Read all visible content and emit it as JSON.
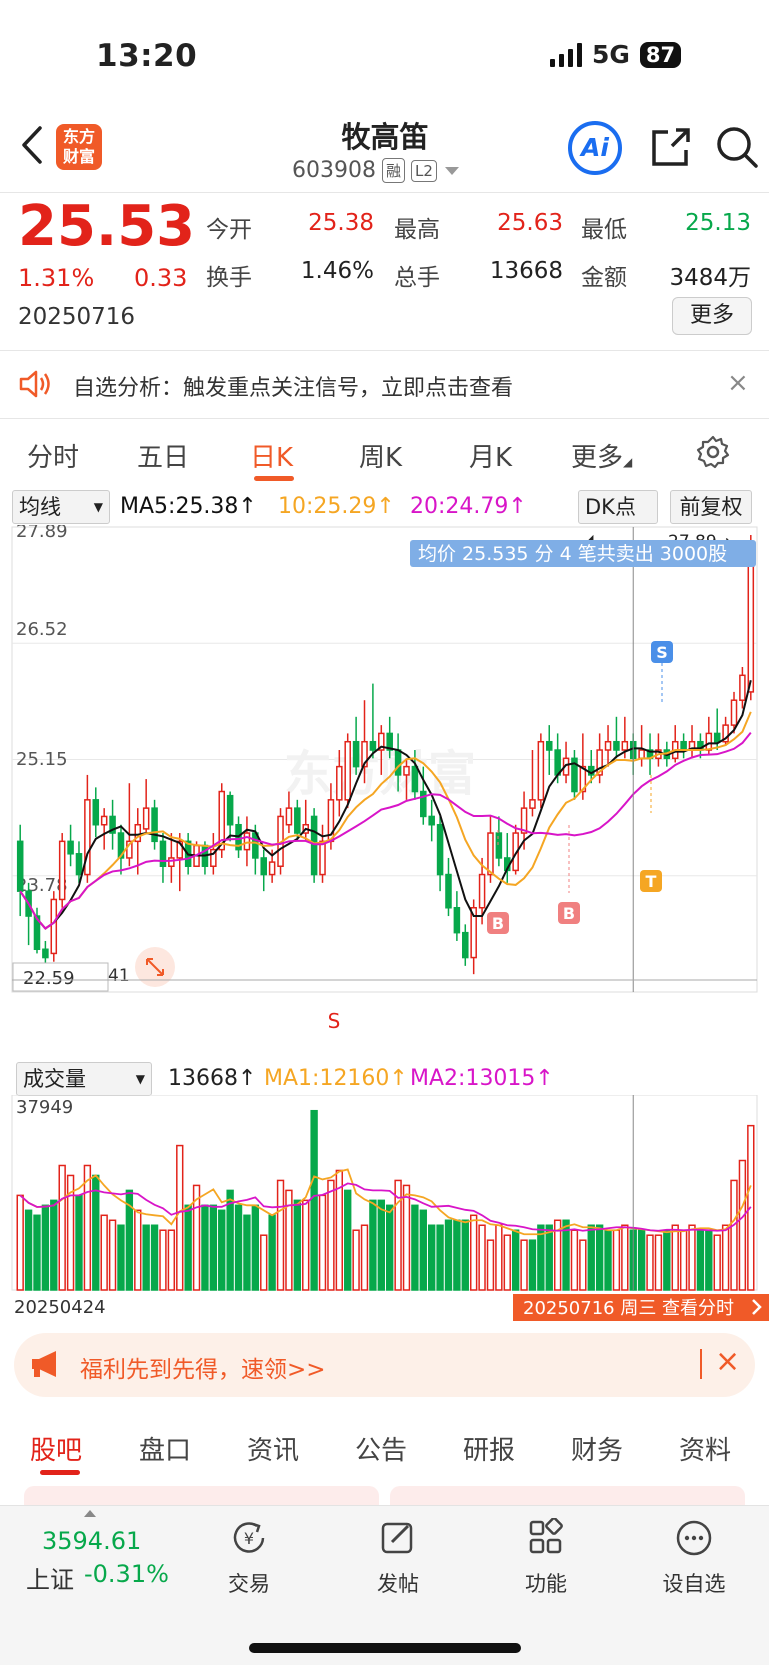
{
  "status": {
    "time": "13:20",
    "network": "5G",
    "battery": "87"
  },
  "header": {
    "logo_line1": "东方",
    "logo_line2": "财富",
    "stock_name": "牧高笛",
    "stock_code": "603908",
    "tag_margin": "融",
    "tag_level": "L2",
    "ai_label": "Ai"
  },
  "quote": {
    "price": "25.53",
    "change_pct": "1.31%",
    "change_amt": "0.33",
    "date": "20250716",
    "open_label": "今开",
    "open": "25.38",
    "high_label": "最高",
    "high": "25.63",
    "low_label": "最低",
    "low": "25.13",
    "turnover_label": "换手",
    "turnover": "1.46%",
    "volume_label": "总手",
    "volume": "13668",
    "amount_label": "金额",
    "amount": "3484万",
    "more_label": "更多"
  },
  "notice": {
    "text": "自选分析：触发重点关注信号，立即点击查看",
    "close": "×"
  },
  "chart_tabs": [
    "分时",
    "五日",
    "日K",
    "周K",
    "月K",
    "更多"
  ],
  "active_chart_tab": "日K",
  "ma_row": {
    "indicator_select": "均线",
    "ma5": "MA5:25.38↑",
    "ma10": "10:25.29↑",
    "ma20": "20:24.79↑",
    "dk_select": "DK点",
    "adjust_button": "前复权"
  },
  "price_axis": [
    "27.89",
    "26.52",
    "25.15",
    "23.78",
    "22.59"
  ],
  "cursor_price_label": "27.89→",
  "trade_tooltip": "均价 25.535 分 4 笔共卖出 3000股",
  "watermark": "东方财富",
  "low_price_marker": "41",
  "markers": {
    "s_top": "S",
    "s_bottom": "S",
    "b1": "B",
    "b2": "B",
    "t": "T"
  },
  "volume_row": {
    "indicator_select": "成交量",
    "value": "13668↑",
    "ma1": "MA1:12160↑",
    "ma2": "MA2:13015↑",
    "max_label": "37949",
    "start_date": "20250424",
    "cursor_info": "20250716 周三 查看分时"
  },
  "colors": {
    "up": "#e2231a",
    "down": "#07a84b",
    "ma5": "#111111",
    "ma10": "#f5a623",
    "ma20": "#d815c8",
    "accent": "#f05a28"
  },
  "chart_data": {
    "type": "candlestick",
    "ylim": [
      22.59,
      27.89
    ],
    "candles": [
      [
        24.2,
        23.6,
        24.4,
        23.3
      ],
      [
        23.6,
        23.3,
        23.7,
        22.95
      ],
      [
        23.3,
        22.9,
        23.4,
        22.85
      ],
      [
        22.9,
        22.8,
        23.0,
        22.7
      ],
      [
        22.85,
        23.5,
        23.6,
        22.75
      ],
      [
        23.5,
        24.2,
        24.3,
        23.4
      ],
      [
        24.2,
        24.05,
        24.4,
        23.9
      ],
      [
        24.05,
        23.8,
        24.2,
        23.7
      ],
      [
        23.8,
        24.7,
        25.0,
        23.7
      ],
      [
        24.7,
        24.4,
        24.85,
        24.25
      ],
      [
        24.4,
        24.5,
        24.6,
        24.1
      ],
      [
        24.5,
        24.3,
        24.7,
        24.1
      ],
      [
        24.3,
        24.0,
        24.4,
        23.8
      ],
      [
        24.0,
        24.2,
        24.9,
        23.9
      ],
      [
        24.2,
        24.4,
        24.6,
        23.8
      ],
      [
        24.35,
        24.6,
        24.95,
        24.3
      ],
      [
        24.6,
        24.2,
        24.7,
        24.1
      ],
      [
        24.2,
        23.9,
        24.3,
        23.7
      ],
      [
        23.9,
        24.0,
        24.3,
        23.7
      ],
      [
        24.0,
        24.2,
        24.3,
        23.6
      ],
      [
        24.2,
        23.9,
        24.3,
        23.8
      ],
      [
        23.9,
        24.15,
        24.2,
        23.9
      ],
      [
        24.15,
        23.9,
        24.2,
        23.8
      ],
      [
        23.9,
        24.1,
        24.3,
        23.8
      ],
      [
        24.1,
        24.8,
        24.9,
        24.0
      ],
      [
        24.75,
        24.4,
        24.8,
        24.2
      ],
      [
        24.4,
        24.1,
        24.5,
        24.0
      ],
      [
        24.1,
        24.3,
        24.5,
        23.9
      ],
      [
        24.3,
        24.0,
        24.4,
        23.8
      ],
      [
        24.0,
        23.8,
        24.1,
        23.6
      ],
      [
        23.8,
        23.95,
        24.1,
        23.7
      ],
      [
        23.9,
        24.5,
        24.6,
        23.8
      ],
      [
        24.4,
        24.6,
        24.8,
        24.3
      ],
      [
        24.6,
        24.3,
        24.7,
        24.2
      ],
      [
        24.3,
        24.4,
        24.7,
        24.2
      ],
      [
        24.5,
        23.8,
        24.6,
        23.7
      ],
      [
        23.8,
        24.2,
        24.4,
        23.7
      ],
      [
        24.2,
        24.7,
        24.9,
        24.1
      ],
      [
        24.7,
        25.1,
        25.3,
        24.5
      ],
      [
        24.7,
        25.4,
        25.5,
        24.6
      ],
      [
        25.4,
        25.1,
        25.7,
        25.0
      ],
      [
        25.1,
        25.4,
        25.9,
        24.9
      ],
      [
        25.4,
        25.3,
        26.1,
        25.2
      ],
      [
        25.3,
        25.5,
        25.6,
        25.0
      ],
      [
        25.5,
        25.3,
        25.7,
        25.2
      ],
      [
        25.3,
        25.0,
        25.5,
        24.8
      ],
      [
        25.0,
        25.1,
        25.2,
        24.7
      ],
      [
        25.1,
        24.8,
        25.3,
        24.7
      ],
      [
        24.8,
        24.5,
        25.1,
        24.4
      ],
      [
        24.5,
        24.4,
        24.7,
        24.2
      ],
      [
        24.4,
        23.8,
        24.5,
        23.6
      ],
      [
        23.8,
        23.4,
        24.0,
        23.3
      ],
      [
        23.4,
        23.1,
        23.6,
        23.0
      ],
      [
        23.1,
        22.8,
        23.2,
        22.7
      ],
      [
        22.8,
        23.4,
        23.5,
        22.6
      ],
      [
        23.4,
        23.8,
        24.0,
        23.2
      ],
      [
        23.8,
        24.3,
        24.5,
        23.7
      ],
      [
        24.3,
        24.0,
        24.5,
        23.9
      ],
      [
        24.0,
        23.85,
        24.3,
        23.7
      ],
      [
        23.85,
        24.3,
        24.4,
        23.8
      ],
      [
        24.3,
        24.6,
        24.8,
        24.1
      ],
      [
        24.6,
        24.7,
        25.3,
        24.5
      ],
      [
        24.7,
        25.4,
        25.5,
        24.6
      ],
      [
        25.4,
        25.3,
        25.6,
        25.0
      ],
      [
        25.3,
        25.0,
        25.5,
        24.9
      ],
      [
        25.0,
        25.2,
        25.4,
        24.9
      ],
      [
        25.2,
        24.8,
        25.3,
        24.7
      ],
      [
        24.8,
        25.1,
        25.5,
        24.7
      ],
      [
        25.1,
        25.0,
        25.3,
        24.9
      ],
      [
        25.0,
        25.3,
        25.5,
        24.9
      ],
      [
        25.3,
        25.4,
        25.6,
        25.1
      ],
      [
        25.4,
        25.3,
        25.7,
        25.2
      ],
      [
        25.3,
        25.4,
        25.7,
        25.2
      ],
      [
        25.4,
        25.2,
        25.5,
        25.0
      ],
      [
        25.2,
        25.3,
        25.6,
        25.1
      ],
      [
        25.3,
        25.2,
        25.5,
        25.0
      ],
      [
        25.2,
        25.3,
        25.5,
        25.1
      ],
      [
        25.3,
        25.2,
        25.4,
        25.1
      ],
      [
        25.2,
        25.4,
        25.6,
        25.15
      ],
      [
        25.4,
        25.3,
        25.5,
        25.2
      ],
      [
        25.3,
        25.4,
        25.6,
        25.2
      ],
      [
        25.4,
        25.3,
        25.5,
        25.2
      ],
      [
        25.3,
        25.5,
        25.7,
        25.25
      ],
      [
        25.5,
        25.4,
        25.8,
        25.3
      ],
      [
        25.4,
        25.6,
        25.7,
        25.35
      ],
      [
        25.6,
        25.9,
        26.0,
        25.5
      ],
      [
        25.9,
        26.2,
        26.3,
        25.8
      ],
      [
        26.0,
        27.6,
        27.89,
        25.9
      ]
    ]
  },
  "volume_data": {
    "max": 37949,
    "bars": [
      [
        19000,
        1
      ],
      [
        16000,
        0
      ],
      [
        15000,
        0
      ],
      [
        17000,
        0
      ],
      [
        18000,
        0
      ],
      [
        25000,
        1
      ],
      [
        23000,
        1
      ],
      [
        19000,
        0
      ],
      [
        25000,
        1
      ],
      [
        23000,
        0
      ],
      [
        15000,
        1
      ],
      [
        14000,
        1
      ],
      [
        13000,
        0
      ],
      [
        20000,
        0
      ],
      [
        16000,
        1
      ],
      [
        13000,
        0
      ],
      [
        13000,
        0
      ],
      [
        12000,
        1
      ],
      [
        12000,
        1
      ],
      [
        29000,
        1
      ],
      [
        17000,
        0
      ],
      [
        21000,
        1
      ],
      [
        17000,
        0
      ],
      [
        17000,
        0
      ],
      [
        16000,
        0
      ],
      [
        20000,
        0
      ],
      [
        17000,
        0
      ],
      [
        15000,
        0
      ],
      [
        17000,
        0
      ],
      [
        11000,
        1
      ],
      [
        15000,
        0
      ],
      [
        22000,
        1
      ],
      [
        20000,
        1
      ],
      [
        18000,
        0
      ],
      [
        18000,
        1
      ],
      [
        36000,
        0
      ],
      [
        19000,
        1
      ],
      [
        22000,
        1
      ],
      [
        24000,
        1
      ],
      [
        20000,
        0
      ],
      [
        12000,
        1
      ],
      [
        13000,
        1
      ],
      [
        18000,
        0
      ],
      [
        18000,
        0
      ],
      [
        17000,
        0
      ],
      [
        22000,
        1
      ],
      [
        21000,
        1
      ],
      [
        17000,
        0
      ],
      [
        16000,
        0
      ],
      [
        13000,
        0
      ],
      [
        13000,
        0
      ],
      [
        14000,
        0
      ],
      [
        14000,
        0
      ],
      [
        14000,
        0
      ],
      [
        15000,
        1
      ],
      [
        13000,
        1
      ],
      [
        10000,
        1
      ],
      [
        13000,
        1
      ],
      [
        11000,
        1
      ],
      [
        12000,
        0
      ],
      [
        10000,
        1
      ],
      [
        10000,
        0
      ],
      [
        13000,
        0
      ],
      [
        13000,
        0
      ],
      [
        14000,
        1
      ],
      [
        14000,
        0
      ],
      [
        12000,
        1
      ],
      [
        10000,
        1
      ],
      [
        13000,
        0
      ],
      [
        13000,
        0
      ],
      [
        12000,
        0
      ],
      [
        12000,
        1
      ],
      [
        13000,
        1
      ],
      [
        12000,
        0
      ],
      [
        12000,
        0
      ],
      [
        11000,
        1
      ],
      [
        11000,
        1
      ],
      [
        12000,
        0
      ],
      [
        13000,
        1
      ],
      [
        12000,
        1
      ],
      [
        13000,
        1
      ],
      [
        12000,
        0
      ],
      [
        12000,
        0
      ],
      [
        11000,
        1
      ],
      [
        13000,
        1
      ],
      [
        22000,
        1
      ],
      [
        26000,
        1
      ],
      [
        33000,
        1
      ]
    ]
  },
  "promo": {
    "text": "福利先到先得，速领>>",
    "close": "×"
  },
  "bottom_tabs": [
    "股吧",
    "盘口",
    "资讯",
    "公告",
    "研报",
    "财务",
    "资料"
  ],
  "active_bottom_tab": "股吧",
  "navbar": {
    "index_value": "3594.61",
    "index_name": "上证",
    "index_change": "-0.31%",
    "items": [
      "交易",
      "发帖",
      "功能",
      "设自选"
    ]
  }
}
